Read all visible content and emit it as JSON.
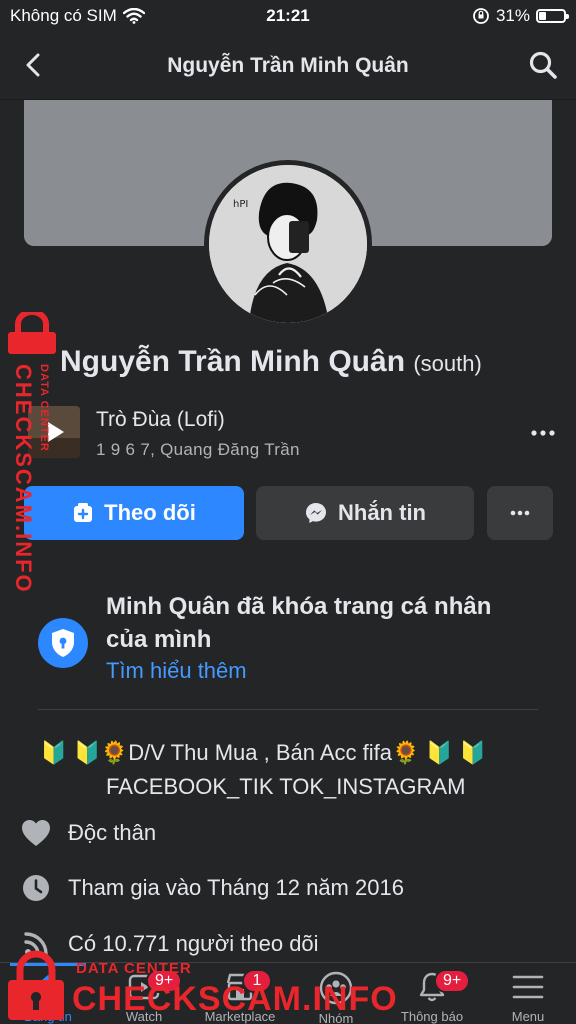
{
  "status_bar": {
    "carrier": "Không có SIM",
    "time": "21:21",
    "battery": "31%",
    "battery_level": 0.31
  },
  "nav": {
    "title": "Nguyễn Trần Minh Quân",
    "back_icon": "chevron-left-icon",
    "search_icon": "search-icon"
  },
  "profile": {
    "name": "Nguyễn Trần Minh Quân",
    "alternate_name": "(south)"
  },
  "music": {
    "title": "Trò Đùa (Lofi)",
    "artist": "1 9 6 7, Quang Đăng Trần"
  },
  "actions": {
    "follow_label": "Theo dõi",
    "message_label": "Nhắn tin"
  },
  "locked": {
    "message": "Minh Quân đã khóa trang cá nhân của mình",
    "learn_more": "Tìm hiểu thêm"
  },
  "bio": {
    "line1": "🔰 🔰🌻D/V Thu Mua , Bán Acc fifa🌻 🔰 🔰",
    "line2": "FACEBOOK_TIK TOK_INSTAGRAM"
  },
  "intro": {
    "relationship": "Độc thân",
    "joined": "Tham gia vào Tháng 12 năm 2016",
    "followers": "Có 10.771 người theo dõi"
  },
  "tabs": [
    {
      "label": "Bảng tin",
      "icon": "home-icon",
      "badge": ""
    },
    {
      "label": "Watch",
      "icon": "watch-icon",
      "badge": "9+"
    },
    {
      "label": "Marketplace",
      "icon": "marketplace-icon",
      "badge": "1"
    },
    {
      "label": "Nhóm",
      "icon": "groups-icon",
      "badge": ""
    },
    {
      "label": "Thông báo",
      "icon": "bell-icon",
      "badge": "9+"
    },
    {
      "label": "Menu",
      "icon": "menu-icon",
      "badge": ""
    }
  ],
  "watermark": {
    "big": "CHECKSCAM.INFO",
    "small": "DATA CENTER"
  },
  "colors": {
    "background": "#242526",
    "accent": "#2d88ff",
    "badge": "#e41e3f",
    "watermark": "#e8262b"
  }
}
